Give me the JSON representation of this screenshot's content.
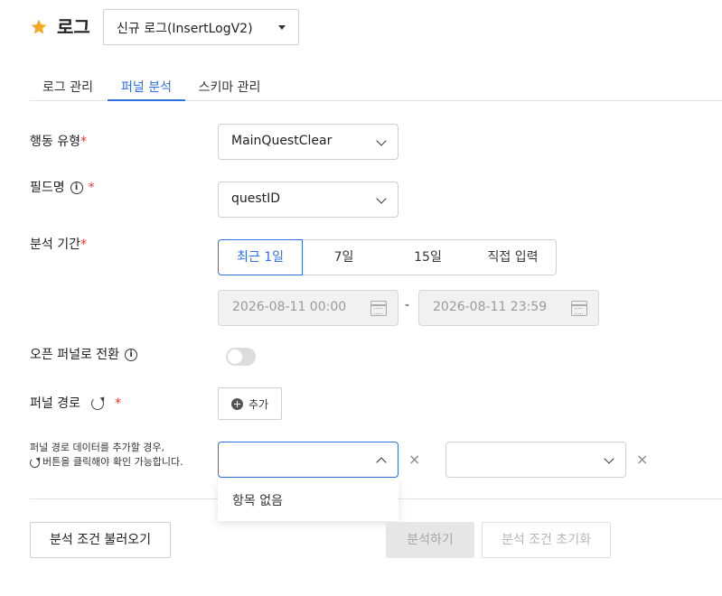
{
  "header": {
    "title": "로그",
    "log_select_value": "신규 로그(InsertLogV2)",
    "star_color": "#f5a623"
  },
  "tabs": [
    {
      "label": "로그 관리",
      "active": false
    },
    {
      "label": "퍼널 분석",
      "active": true
    },
    {
      "label": "스키마 관리",
      "active": false
    }
  ],
  "form": {
    "action_type": {
      "label": "행동 유형",
      "required_mark": "*",
      "value": "MainQuestClear"
    },
    "field_name": {
      "label": "필드명",
      "required_mark": "*",
      "value": "questID",
      "info_icon": "i"
    },
    "period": {
      "label": "분석 기간",
      "required_mark": "*",
      "options": [
        "최근 1일",
        "7일",
        "15일",
        "직접 입력"
      ],
      "selected": "최근 1일",
      "start": "2026-08-11 00:00",
      "end": "2026-08-11 23:59",
      "separator": "-"
    },
    "open_funnel": {
      "label": "오픈 퍼널로 전환",
      "info_icon": "i",
      "enabled": false
    },
    "funnel_path": {
      "label": "퍼널 경로",
      "required_mark": "*",
      "add_label": "추가",
      "help_line1": "퍼널 경로 데이터를 추가할 경우,",
      "help_line2": "버튼을 클릭해야 확인 가능합니다.",
      "step1_value": "",
      "step2_value": "",
      "remove_symbol": "×",
      "dropdown_empty": "항목 없음"
    }
  },
  "footer": {
    "load_conditions": "분석 조건 불러오기",
    "analyze": "분석하기",
    "reset_conditions": "분석 조건 초기화"
  },
  "colors": {
    "accent": "#2f6fde",
    "required": "#e53935"
  }
}
